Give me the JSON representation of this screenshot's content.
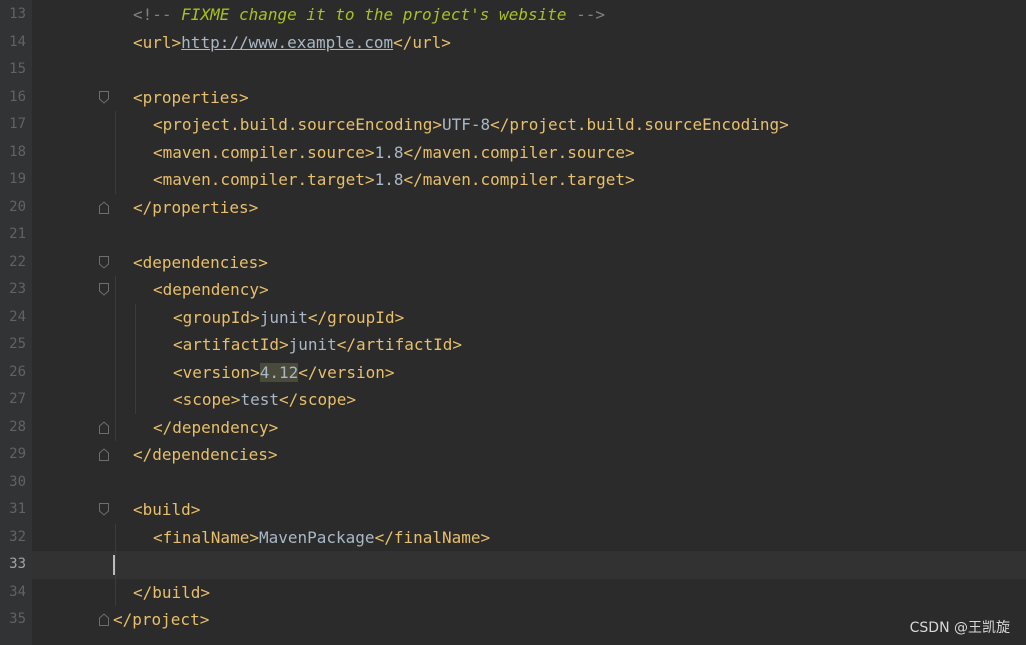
{
  "editor": {
    "lines": [
      {
        "num": "13",
        "segments": [
          {
            "c": "cmt",
            "t": "<!-- "
          },
          {
            "c": "todo",
            "t": "FIXME change it to the project's website"
          },
          {
            "c": "cmt",
            "t": " -->"
          }
        ],
        "indent": 1
      },
      {
        "num": "14",
        "segments": [
          {
            "c": "tag",
            "t": "<url>"
          },
          {
            "c": "link",
            "t": "http://www.example.com"
          },
          {
            "c": "tag",
            "t": "</url>"
          }
        ],
        "indent": 1
      },
      {
        "num": "15",
        "segments": [],
        "indent": 0
      },
      {
        "num": "16",
        "segments": [
          {
            "c": "tag",
            "t": "<properties>"
          }
        ],
        "indent": 1,
        "fold": "open"
      },
      {
        "num": "17",
        "segments": [
          {
            "c": "tag",
            "t": "<project.build.sourceEncoding>"
          },
          {
            "c": "txt",
            "t": "UTF-8"
          },
          {
            "c": "tag",
            "t": "</project.build.sourceEncoding>"
          }
        ],
        "indent": 2
      },
      {
        "num": "18",
        "segments": [
          {
            "c": "tag",
            "t": "<maven.compiler.source>"
          },
          {
            "c": "txt",
            "t": "1.8"
          },
          {
            "c": "tag",
            "t": "</maven.compiler.source>"
          }
        ],
        "indent": 2
      },
      {
        "num": "19",
        "segments": [
          {
            "c": "tag",
            "t": "<maven.compiler.target>"
          },
          {
            "c": "txt",
            "t": "1.8"
          },
          {
            "c": "tag",
            "t": "</maven.compiler.target>"
          }
        ],
        "indent": 2
      },
      {
        "num": "20",
        "segments": [
          {
            "c": "tag",
            "t": "</properties>"
          }
        ],
        "indent": 1,
        "fold": "close"
      },
      {
        "num": "21",
        "segments": [],
        "indent": 0
      },
      {
        "num": "22",
        "segments": [
          {
            "c": "tag",
            "t": "<dependencies>"
          }
        ],
        "indent": 1,
        "fold": "open"
      },
      {
        "num": "23",
        "segments": [
          {
            "c": "tag",
            "t": "<dependency>"
          }
        ],
        "indent": 2,
        "fold": "open"
      },
      {
        "num": "24",
        "segments": [
          {
            "c": "tag",
            "t": "<groupId>"
          },
          {
            "c": "txt",
            "t": "junit"
          },
          {
            "c": "tag",
            "t": "</groupId>"
          }
        ],
        "indent": 3
      },
      {
        "num": "25",
        "segments": [
          {
            "c": "tag",
            "t": "<artifactId>"
          },
          {
            "c": "txt",
            "t": "junit"
          },
          {
            "c": "tag",
            "t": "</artifactId>"
          }
        ],
        "indent": 3
      },
      {
        "num": "26",
        "segments": [
          {
            "c": "tag",
            "t": "<version>"
          },
          {
            "c": "txt hl",
            "t": "4.12"
          },
          {
            "c": "tag",
            "t": "</version>"
          }
        ],
        "indent": 3
      },
      {
        "num": "27",
        "segments": [
          {
            "c": "tag",
            "t": "<scope>"
          },
          {
            "c": "txt",
            "t": "test"
          },
          {
            "c": "tag",
            "t": "</scope>"
          }
        ],
        "indent": 3
      },
      {
        "num": "28",
        "segments": [
          {
            "c": "tag",
            "t": "</dependency>"
          }
        ],
        "indent": 2,
        "fold": "close"
      },
      {
        "num": "29",
        "segments": [
          {
            "c": "tag",
            "t": "</dependencies>"
          }
        ],
        "indent": 1,
        "fold": "close"
      },
      {
        "num": "30",
        "segments": [],
        "indent": 0
      },
      {
        "num": "31",
        "segments": [
          {
            "c": "tag",
            "t": "<build>"
          }
        ],
        "indent": 1,
        "fold": "open"
      },
      {
        "num": "32",
        "segments": [
          {
            "c": "tag",
            "t": "<finalName>"
          },
          {
            "c": "txt",
            "t": "MavenPackage"
          },
          {
            "c": "tag",
            "t": "</finalName>"
          }
        ],
        "indent": 2
      },
      {
        "num": "33",
        "segments": [],
        "indent": 0,
        "current": true
      },
      {
        "num": "34",
        "segments": [
          {
            "c": "tag",
            "t": "</build>"
          }
        ],
        "indent": 1
      },
      {
        "num": "35",
        "segments": [
          {
            "c": "tag",
            "t": "</project>"
          }
        ],
        "indent": 0,
        "fold": "close"
      }
    ],
    "cut_text": "...int... build..."
  },
  "watermark": "CSDN @王凯旋",
  "colors": {
    "tag": "#e8bf6a",
    "text": "#a9b7c6",
    "comment": "#808080",
    "todo": "#a8c023",
    "background": "#2b2b2b",
    "gutter": "#313335"
  }
}
